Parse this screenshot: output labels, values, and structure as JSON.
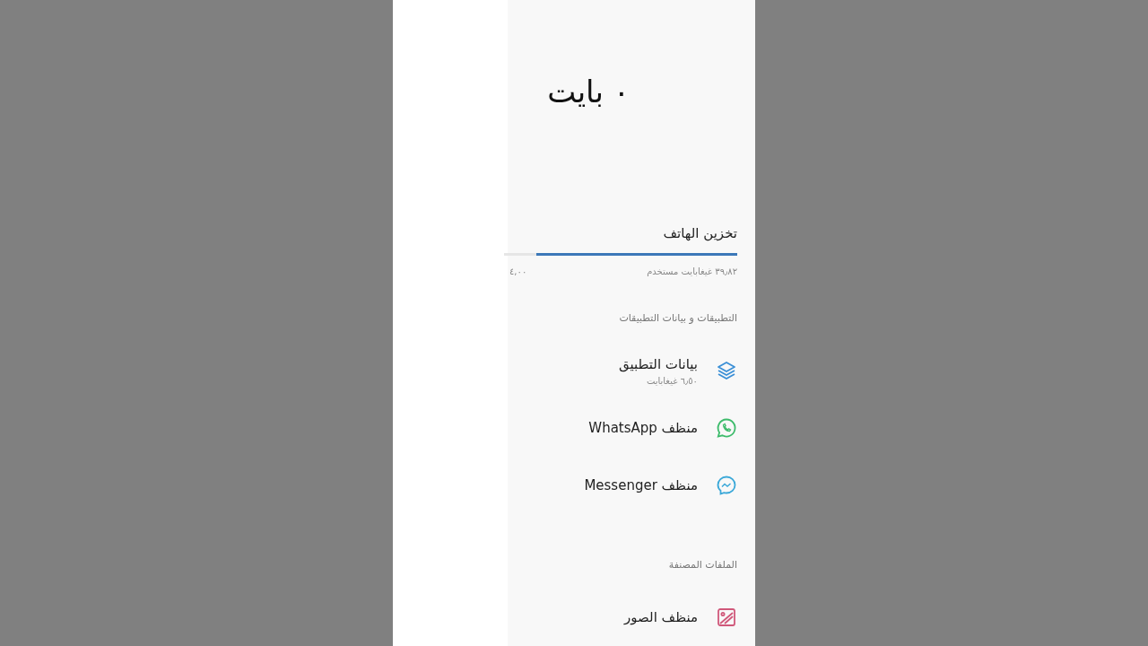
{
  "overlay_text": "٠ بايت",
  "storage": {
    "title": "تخزين الهاتف",
    "level": 0.86,
    "used": "٣٩٫٨٢ غيغابايت مستخدم",
    "total": "٤,٠٠"
  },
  "sections": [
    {
      "heading": "التطبيقات و بيانات التطبيقات",
      "items": [
        {
          "kind": "layers",
          "title": "بيانات التطبيق",
          "subtitle": "٦٫٥٠ غيغابايت"
        },
        {
          "kind": "whatsapp",
          "title": "منظف WhatsApp"
        },
        {
          "kind": "messenger",
          "title": "منظف Messenger"
        }
      ]
    },
    {
      "heading": "الملفات المصنفة",
      "items": [
        {
          "kind": "image",
          "title": "منظف الصور"
        }
      ]
    }
  ]
}
